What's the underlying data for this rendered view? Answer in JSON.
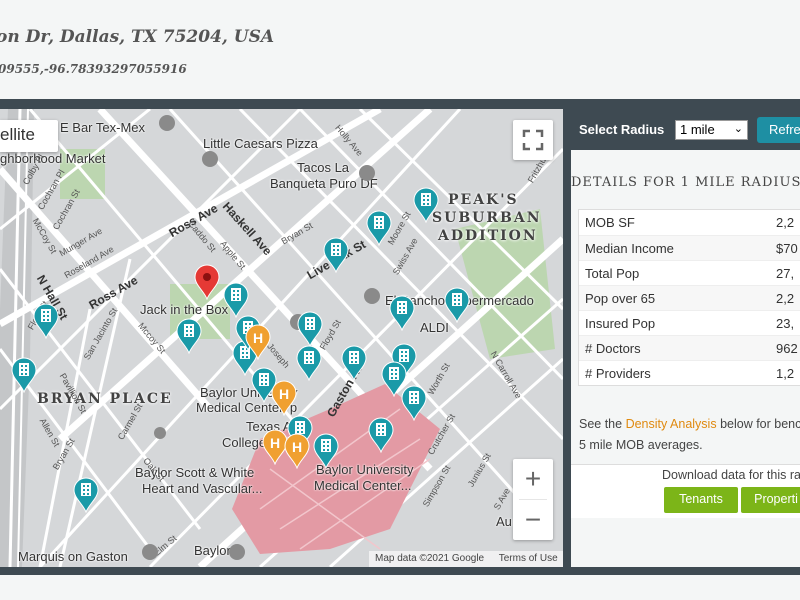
{
  "header": {
    "address": "on Dr, Dallas, TX 75204, USA",
    "coordinates": "09555,-96.78393297055916"
  },
  "map": {
    "satellite_label": "ellite",
    "zoom_in": "+",
    "zoom_out": "−",
    "attribution": {
      "map_data": "Map data ©2021 Google",
      "terms": "Terms of Use"
    },
    "districts": {
      "peaks": [
        "PEAK'S",
        "SUBURBAN",
        "ADDITION"
      ],
      "bryan": "BRYAN PLACE"
    },
    "pois": {
      "bar_texmex": "E Bar Tex-Mex",
      "little_caesars": "Little Caesars Pizza",
      "neighborhood_market": "ghborhood Market",
      "tacos_la": "Tacos La",
      "banqueta": "Banqueta Puro DF",
      "jack": "Jack in the Box",
      "el_rancho": "El Rancho Supermercado",
      "aldi": "ALDI",
      "baylor_med_1": "Baylor University",
      "baylor_med_2": "Medical Center, p",
      "texas_am_1": "Texas A&M",
      "texas_am_2": "College of De",
      "bsw_1": "Baylor Scott & White",
      "bsw_2": "Heart and Vascular...",
      "bumc_1": "Baylor University",
      "bumc_2": "Medical Center...",
      "marquis": "Marquis on Gaston",
      "baylor": "Baylor",
      "au": "Au"
    },
    "streets": {
      "ross1": "Ross Ave",
      "ross2": "Ross Ave",
      "haskell": "Haskell Ave",
      "live_oak": "Live Oak St",
      "gaston": "Gaston Ave",
      "n_hall": "N Hall St",
      "small": [
        "Colby Pl",
        "McCoy St",
        "Cochran Pl",
        "Cochran St",
        "Munger Ave",
        "Roseland Ave",
        "Caddo St",
        "Apple St",
        "Bryan St",
        "Holly Ave",
        "Moore St",
        "Swiss Ave",
        "Fritzhugh",
        "San Jacinto St",
        "Mccoy St",
        "Flora St",
        "Pavillion St",
        "Allen St",
        "Bryan St",
        "Carmel St",
        "Oak St",
        "St Joseph",
        "Floyd St",
        "Worth St",
        "N Carroll Ave",
        "Crutcher St",
        "Simpson St",
        "Junius St",
        "Elm St",
        "S Ave"
      ]
    },
    "legend_colors": {
      "hospital": "#f0a030",
      "mob": "#1a9aa8",
      "location": "#e53935",
      "medical_zone": "#e39aa4"
    }
  },
  "panel": {
    "select_radius_label": "Select Radius",
    "radius_value": "1 mile",
    "refresh_label": "Refre",
    "details_title": "DETAILS FOR 1 MILE RADIUS",
    "stats": [
      {
        "label": "MOB SF",
        "value": "2,2"
      },
      {
        "label": "Median Income",
        "value": "$70"
      },
      {
        "label": "Total Pop",
        "value": "27,"
      },
      {
        "label": "Pop over 65",
        "value": "2,2"
      },
      {
        "label": "Insured Pop",
        "value": "23,"
      },
      {
        "label": "# Doctors",
        "value": "962"
      },
      {
        "label": "# Providers",
        "value": "1,2"
      }
    ],
    "density_pre": "See the ",
    "density_link": "Density Analysis",
    "density_post": " below for benc",
    "density_line2": "5 mile MOB averages.",
    "download_text": "Download data for this ra",
    "tenants_label": "Tenants",
    "properties_label": "Properti"
  }
}
